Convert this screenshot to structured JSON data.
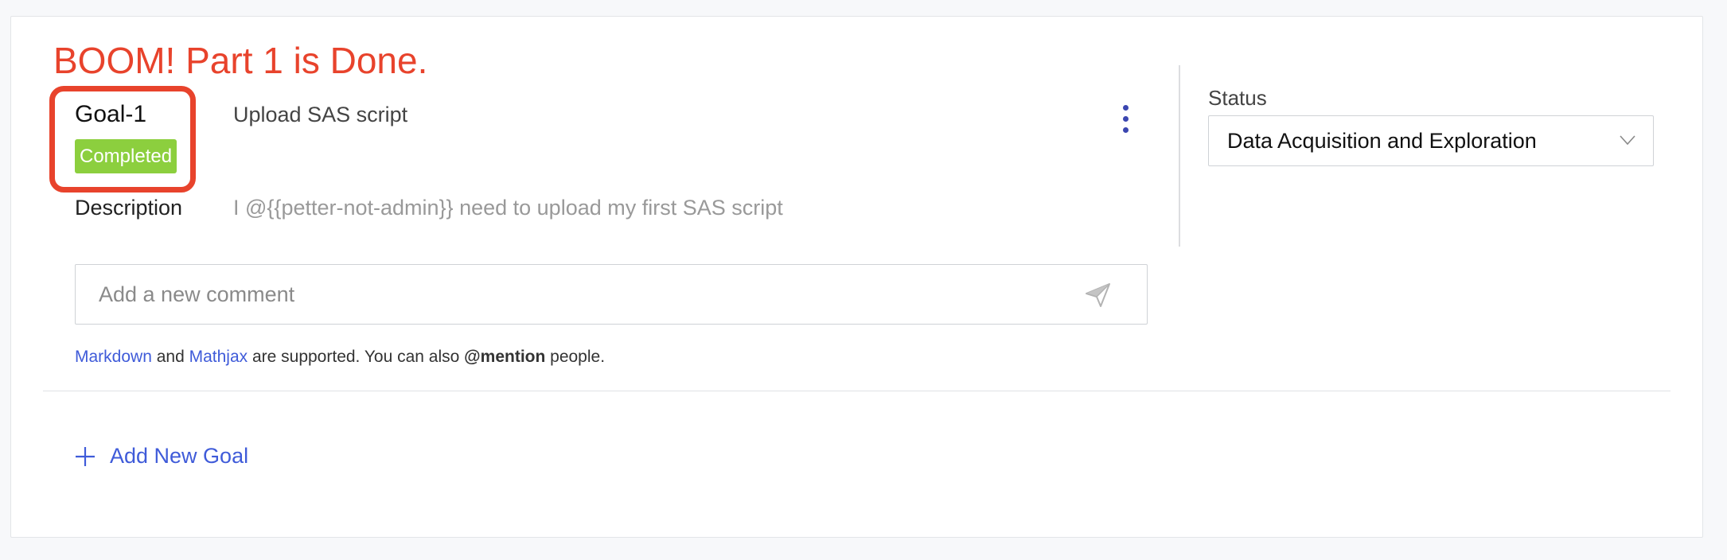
{
  "annotation": {
    "text": "BOOM! Part 1 is Done.",
    "color": "#e8432c"
  },
  "goal": {
    "id": "Goal-1",
    "status_badge": "Completed",
    "title": "Upload SAS script",
    "description_label": "Description",
    "description": "I @{{petter-not-admin}} need to upload my first SAS script",
    "more_icon": "vertical-ellipsis-icon"
  },
  "comment": {
    "placeholder": "Add a new comment",
    "send_icon": "send-icon",
    "help": {
      "markdown_link": "Markdown",
      "and": " and ",
      "mathjax_link": "Mathjax",
      "middle": " are supported. You can also ",
      "mention": "@mention",
      "end": " people."
    }
  },
  "status_panel": {
    "label": "Status",
    "selected": "Data Acquisition and Exploration",
    "chevron_icon": "chevron-down-icon"
  },
  "add_goal": {
    "label": "Add New Goal",
    "icon": "plus-icon"
  },
  "colors": {
    "accent": "#3f5bd9",
    "badge": "#8ccf3e",
    "kebab": "#3b46b0"
  }
}
